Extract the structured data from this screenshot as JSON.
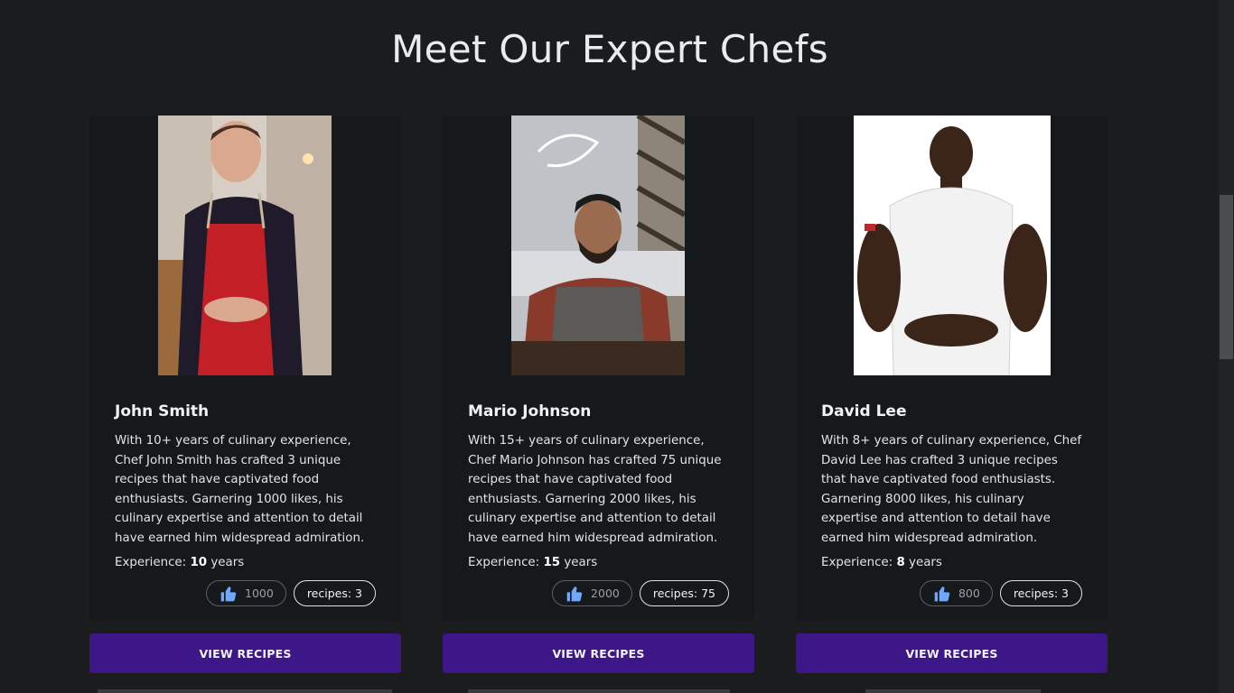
{
  "page": {
    "title": "Meet Our Expert Chefs"
  },
  "button_label": "VIEW RECIPES",
  "accent_color": "#3d1688",
  "chefs": [
    {
      "name": "John Smith",
      "bio": "With 10+ years of culinary experience, Chef John Smith has crafted 3 unique recipes that have captivated food enthusiasts. Garnering 1000 likes, his culinary expertise and attention to detail have earned him widespread admiration.",
      "experience_label": "Experience:",
      "experience_years": "10",
      "years_unit": "years",
      "likes": "1000",
      "recipes": "recipes: 3",
      "like_icon": "thumbs-up-icon"
    },
    {
      "name": "Mario Johnson",
      "bio": "With 15+ years of culinary experience, Chef Mario Johnson has crafted 75 unique recipes that have captivated food enthusiasts. Garnering 2000 likes, his culinary expertise and attention to detail have earned him widespread admiration.",
      "experience_label": "Experience:",
      "experience_years": "15",
      "years_unit": "years",
      "likes": "2000",
      "recipes": "recipes: 75",
      "like_icon": "thumbs-up-icon"
    },
    {
      "name": "David Lee",
      "bio": "With 8+ years of culinary experience, Chef David Lee has crafted 3 unique recipes that have captivated food enthusiasts. Garnering 8000 likes, his culinary expertise and attention to detail have earned him widespread admiration.",
      "experience_label": "Experience:",
      "experience_years": "8",
      "years_unit": "years",
      "likes": "800",
      "recipes": "recipes: 3",
      "like_icon": "thumbs-up-icon"
    }
  ]
}
